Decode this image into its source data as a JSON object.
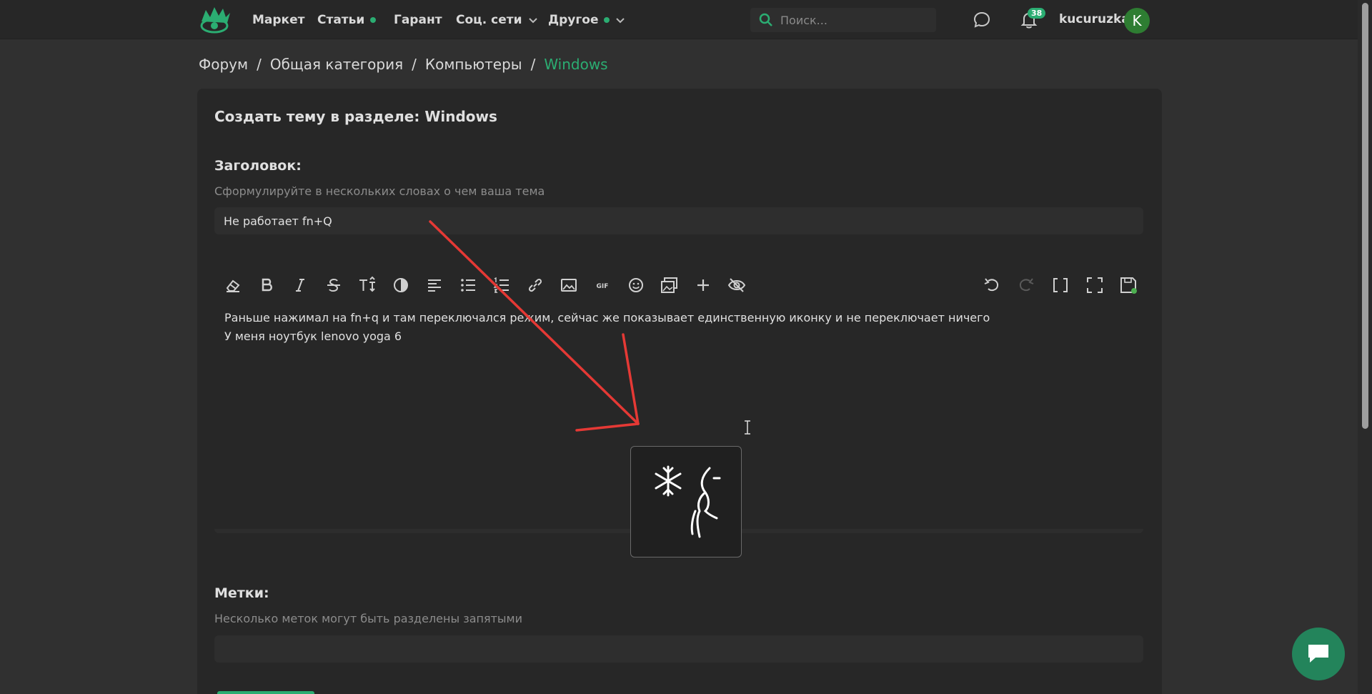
{
  "nav": {
    "items": [
      {
        "label": "Маркет"
      },
      {
        "label": "Статьи"
      },
      {
        "label": "Гарант"
      },
      {
        "label": "Соц. сети"
      },
      {
        "label": "Другое"
      }
    ],
    "search_placeholder": "Поиск...",
    "notification_count": "38",
    "username": "kucuruzka",
    "avatar_letter": "K"
  },
  "breadcrumb": {
    "items": [
      "Форум",
      "Общая категория",
      "Компьютеры"
    ],
    "current": "Windows",
    "separator": "/"
  },
  "form": {
    "title": "Создать тему в разделе: Windows",
    "heading_label": "Заголовок:",
    "heading_hint": "Сформулируйте в нескольких словах о чем ваша тема",
    "heading_value": "Не работает fn+Q",
    "body_line1": "Раньше нажимал на fn+q и там переключался режим, сейчас же показывает единственную иконку и не переключает ничего",
    "body_line2": "У меня ноутбук lenovo yoga 6",
    "tags_label": "Метки:",
    "tags_hint": "Несколько меток могут быть разделены запятыми",
    "tags_value": ""
  },
  "toolbar": {
    "left": [
      "eraser-icon",
      "bold-icon",
      "italic-icon",
      "strikethrough-icon",
      "text-size-icon",
      "color-icon",
      "align-icon",
      "bullet-list-icon",
      "numbered-list-icon",
      "link-icon",
      "image-icon",
      "gif-icon",
      "emoji-icon",
      "gallery-icon",
      "plus-icon",
      "hide-icon"
    ],
    "right": [
      "undo-icon",
      "redo-icon",
      "brackets-icon",
      "fullscreen-icon",
      "save-draft-icon"
    ],
    "gif_label": "GIF"
  },
  "colors": {
    "accent": "#2bad72",
    "annotation_arrow": "#e53935"
  }
}
